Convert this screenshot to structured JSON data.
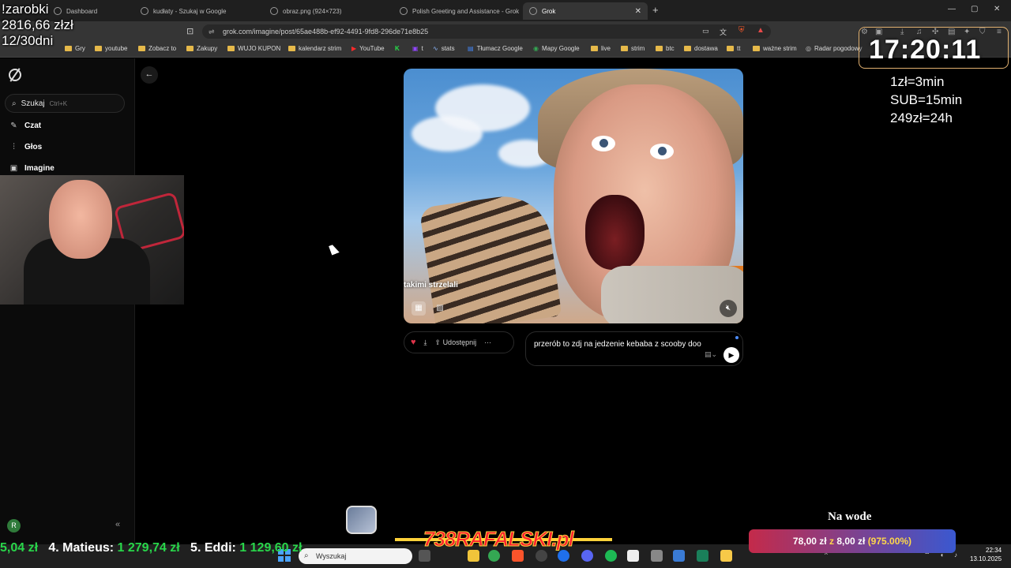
{
  "browser": {
    "tabs": [
      {
        "label": "Dashboard",
        "active": false
      },
      {
        "label": "kudłaty - Szukaj w Google",
        "active": false
      },
      {
        "label": "obraz.png (924×723)",
        "active": false
      },
      {
        "label": "Polish Greeting and Assistance - Grok",
        "active": false
      },
      {
        "label": "Grok",
        "active": true
      }
    ],
    "url": "grok.com/imagine/post/65ae488b-ef92-4491-9fd8-296de71e8b25",
    "bookmarks": [
      "Gry",
      "youtube",
      "Zobacz to",
      "Zakupy",
      "WUJO KUPON",
      "kalendarz strim",
      "YouTube",
      "t",
      "stats",
      "Tłumacz Google",
      "Mapy Google",
      "live",
      "strim",
      "btc",
      "dostawa",
      "tt",
      "ważne strim",
      "Radar pogodowy"
    ]
  },
  "sidebar": {
    "search_label": "Szukaj",
    "search_shortcut": "Ctrl+K",
    "items": [
      {
        "label": "Czat",
        "icon": "edit-icon"
      },
      {
        "label": "Głos",
        "icon": "waveform-icon"
      },
      {
        "label": "Imagine",
        "icon": "image-icon"
      }
    ],
    "avatar_letter": "R"
  },
  "post": {
    "caption": "takimi strzelali",
    "share_label": "Udostępnij",
    "prompt_text": "przerób to zdj  na jedzenie kebaba z scooby doo"
  },
  "overlay": {
    "earnings_title": "!zarobki",
    "earnings_value": "2816,66 złzł",
    "days": "12/30dni",
    "timer": "17:20:11",
    "rate1": "1zł=3min",
    "rate2": "SUB=15min",
    "rate3": "249zł=24h",
    "leaderboard": [
      {
        "rank": "",
        "name": "",
        "amount": "5,04 zł"
      },
      {
        "rank": "4.",
        "name": "Matieus:",
        "amount": "1 279,74 zł"
      },
      {
        "rank": "5.",
        "name": "Eddi:",
        "amount": "1 129,60 zł"
      }
    ],
    "banner": "738RAFALSKI.pl",
    "na_wode": "Na wode",
    "goal_main": "78,00 zł",
    "goal_z": "z",
    "goal_target": "8,00 zł",
    "goal_pct": "(975.00%)"
  },
  "taskbar": {
    "search_placeholder": "Wyszukaj",
    "time": "22:34",
    "date": "13.10.2025"
  },
  "colors": {
    "accent_heart": "#e0344a",
    "leaderboard_green": "#28d64a",
    "goal_yellow": "#ffd84a"
  }
}
